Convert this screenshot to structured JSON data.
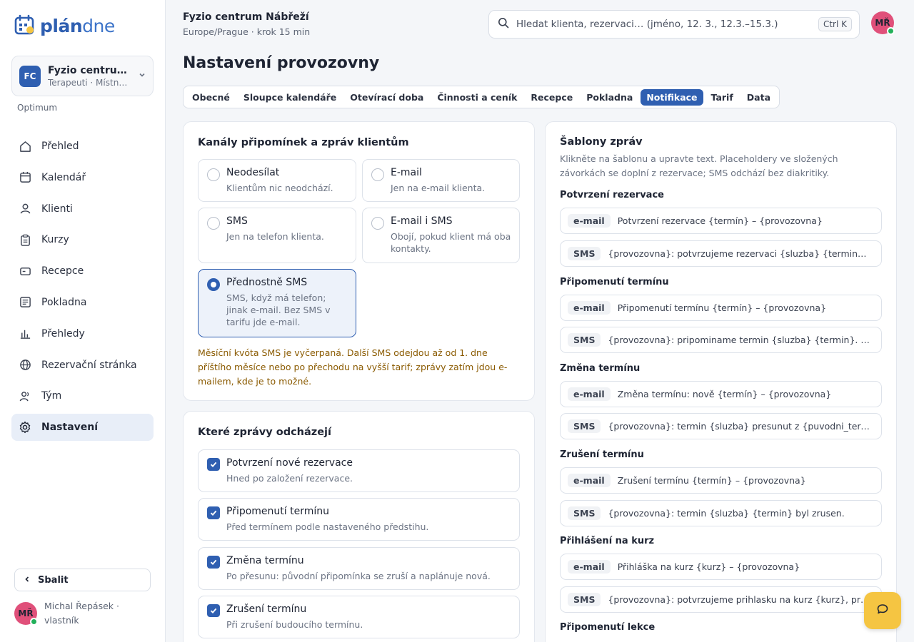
{
  "brand": {
    "name_bold": "plán",
    "name_light": "dne"
  },
  "workspace": {
    "badge": "FC",
    "name": "Fyzio centrum Nábřeží",
    "sub": "Terapeuti · Místnosti",
    "plan": "Optimum"
  },
  "nav": [
    {
      "label": "Přehled",
      "icon": "home-icon"
    },
    {
      "label": "Kalendář",
      "icon": "calendar-icon"
    },
    {
      "label": "Klienti",
      "icon": "user-icon"
    },
    {
      "label": "Kurzy",
      "icon": "clipboard-icon"
    },
    {
      "label": "Recepce",
      "icon": "card-icon"
    },
    {
      "label": "Pokladna",
      "icon": "receipt-icon"
    },
    {
      "label": "Přehledy",
      "icon": "bar-chart-icon"
    },
    {
      "label": "Rezervační stránka",
      "icon": "globe-icon"
    },
    {
      "label": "Tým",
      "icon": "team-icon"
    },
    {
      "label": "Nastavení",
      "icon": "gear-icon",
      "active": true
    }
  ],
  "sidebar": {
    "collapse_label": "Sbalit",
    "user_initials": "MŘ",
    "user_name": "Michal Řepásek · vlastník"
  },
  "header": {
    "org_name": "Fyzio centrum Nábřeží",
    "org_sub": "Europe/Prague · krok 15 min",
    "search_placeholder": "Hledat klienta, rezervaci… (jméno, 12. 3., 12.3.–15.3.)",
    "search_shortcut": "Ctrl K",
    "avatar_initials": "MŘ"
  },
  "page": {
    "title": "Nastavení provozovny"
  },
  "tabs": [
    {
      "label": "Obecné"
    },
    {
      "label": "Sloupce kalendáře"
    },
    {
      "label": "Otevírací doba"
    },
    {
      "label": "Činnosti a ceník"
    },
    {
      "label": "Recepce"
    },
    {
      "label": "Pokladna"
    },
    {
      "label": "Notifikace",
      "active": true
    },
    {
      "label": "Tarif"
    },
    {
      "label": "Data"
    }
  ],
  "channels": {
    "title": "Kanály připomínek a zpráv klientům",
    "options": [
      {
        "title": "Neodesílat",
        "desc": "Klientům nic neodchází.",
        "selected": false
      },
      {
        "title": "E-mail",
        "desc": "Jen na e-mail klienta.",
        "selected": false
      },
      {
        "title": "SMS",
        "desc": "Jen na telefon klienta.",
        "selected": false
      },
      {
        "title": "E-mail i SMS",
        "desc": "Obojí, pokud klient má oba kontakty.",
        "selected": false
      },
      {
        "title": "Přednostně SMS",
        "desc": "SMS, když má telefon; jinak e-mail. Bez SMS v tarifu jde e-mail.",
        "selected": true
      }
    ],
    "warning": "Měsíční kvóta SMS je vyčerpaná. Další SMS odejdou až od 1. dne příštího měsíce nebo po přechodu na vyšší tarif; zprávy zatím jdou e-mailem, kde je to možné."
  },
  "messages": {
    "title": "Které zprávy odcházejí",
    "items": [
      {
        "title": "Potvrzení nové rezervace",
        "desc": "Hned po založení rezervace.",
        "checked": true
      },
      {
        "title": "Připomenutí termínu",
        "desc": "Před termínem podle nastaveného předstihu.",
        "checked": true
      },
      {
        "title": "Změna termínu",
        "desc": "Po přesunu: původní připomínka se zruší a naplánuje nová.",
        "checked": true
      },
      {
        "title": "Zrušení termínu",
        "desc": "Při zrušení budoucího termínu.",
        "checked": true
      }
    ]
  },
  "templates": {
    "title": "Šablony zpráv",
    "desc": "Klikněte na šablonu a upravte text. Placeholdery ve složených závorkách se doplní z rezervace; SMS odchází bez diakritiky.",
    "groups": [
      {
        "title": "Potvrzení rezervace",
        "email_tag": "e-mail",
        "email": "Potvrzení rezervace {termín} – {provozovna}",
        "sms_tag": "SMS",
        "sms": "{provozovna}: potvrzujeme rezervaci {sluzba} {termin}. Zmenu nebo zruseni provedete na {odkaz}"
      },
      {
        "title": "Připomenutí termínu",
        "email_tag": "e-mail",
        "email": "Připomenutí termínu {termín} – {provozovna}",
        "sms_tag": "SMS",
        "sms": "{provozovna}: pripominame termin {sluzba} {termin}. Zruseni na {odkaz}"
      },
      {
        "title": "Změna termínu",
        "email_tag": "e-mail",
        "email": "Změna termínu: nově {termín} – {provozovna}",
        "sms_tag": "SMS",
        "sms": "{provozovna}: termin {sluzba} presunut z {puvodni_termin} na {termin}"
      },
      {
        "title": "Zrušení termínu",
        "email_tag": "e-mail",
        "email": "Zrušení termínu {termín} – {provozovna}",
        "sms_tag": "SMS",
        "sms": "{provozovna}: termin {sluzba} {termin} byl zrusen."
      },
      {
        "title": "Přihlášení na kurz",
        "email_tag": "e-mail",
        "email": "Přihláška na kurz {kurz} – {provozovna}",
        "sms_tag": "SMS",
        "sms": "{provozovna}: potvrzujeme prihlasku na kurz {kurz}, prvni lekce {termin}"
      },
      {
        "title": "Připomenutí lekce"
      }
    ]
  },
  "colors": {
    "accent": "#2f5fb1",
    "warning": "#8a5a00",
    "fab": "#f5c542",
    "avatar": "#e0507a"
  }
}
